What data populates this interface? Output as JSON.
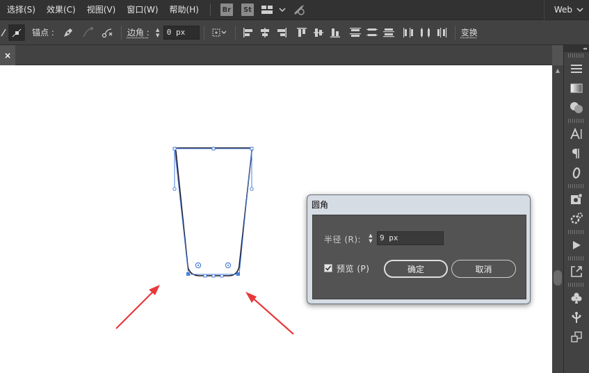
{
  "menubar": {
    "items": [
      "选择(S)",
      "效果(C)",
      "视图(V)",
      "窗口(W)",
      "帮助(H)"
    ],
    "badges": [
      "Br",
      "St"
    ],
    "workspace": "Web",
    "icons": [
      "bridge-icon",
      "stock-icon",
      "arrange-documents-icon",
      "chevron-down-icon",
      "gpu-rocket-icon"
    ]
  },
  "controlbar": {
    "anchor_label": "锚点 :",
    "corner_label": "边角 :",
    "corner_value": "0 px",
    "transform_label": "变换"
  },
  "tab": {
    "close_glyph": "×"
  },
  "dialog": {
    "title": "圆角",
    "radius_label": "半径 (R):",
    "radius_value": "9 px",
    "preview_label": "预览 (P)",
    "preview_checked": true,
    "ok_label": "确定",
    "cancel_label": "取消"
  },
  "colors": {
    "selection_blue": "#4a7fd8",
    "arrow_red": "#e8393a",
    "path_dark": "#1a1a2a"
  }
}
